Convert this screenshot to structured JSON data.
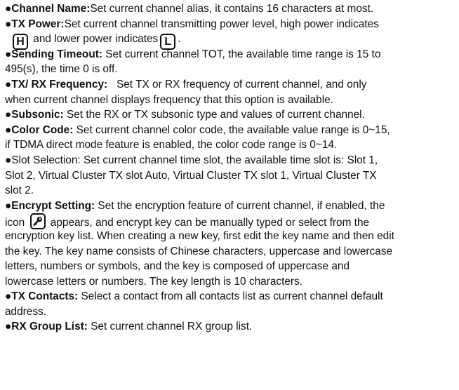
{
  "items": {
    "channel_name": {
      "term": "●Channel Name:",
      "text": "Set current channel alias, it contains 16 characters at most."
    },
    "tx_power": {
      "term": "●TX Power:",
      "text1": "Set current channel transmitting power level, high power indicates",
      "high_key": "H",
      "text2": "and lower power indicates",
      "low_key": "L",
      "end": "."
    },
    "sending_timeout": {
      "term": "●Sending Timeout:",
      "text1": " Set current channel TOT, the available time range is 15 to",
      "text2": "495(s), the time 0 is off."
    },
    "txrx_frequency": {
      "term": "●TX/ RX Frequency:",
      "text1": "   Set TX or RX frequency of current channel, and only",
      "text2": "when current channel displays frequency that this option is available."
    },
    "subsonic": {
      "term": "●Subsonic:",
      "text": " Set the RX or TX subsonic type and values of current channel."
    },
    "color_code": {
      "term": "●Color Code:",
      "text1": " Set current channel color code, the available value range is 0~15,",
      "text2": "if TDMA direct mode feature is enabled, the color code range is 0~14."
    },
    "slot_selection": {
      "line1": "●Slot Selection: Set current channel time slot, the available time slot is: Slot 1,",
      "line2": "Slot 2, Virtual Cluster TX slot Auto, Virtual Cluster TX slot 1, Virtual Cluster TX",
      "line3": "slot 2."
    },
    "encrypt_setting": {
      "term": "●Encrypt Setting:",
      "text1": " Set the encryption feature of current channel, if enabled, the",
      "icon_pre": "icon",
      "icon_post": "appears, and encrypt key can be manually typed or select from the",
      "line3": "encryption key list. When creating a new key, first edit the key name and then edit",
      "line4": "the key. The key name consists of Chinese characters, uppercase and lowercase",
      "line5": "letters, numbers or symbols, and the key is composed of uppercase and",
      "line6": "lowercase letters or numbers. The key length is 10 characters."
    },
    "tx_contacts": {
      "term": "●TX Contacts:",
      "text1": " Select a contact from all contacts list as current channel default",
      "text2": "address."
    },
    "rx_group_list": {
      "term": "●RX Group List:",
      "text": " Set current channel RX group list."
    }
  }
}
